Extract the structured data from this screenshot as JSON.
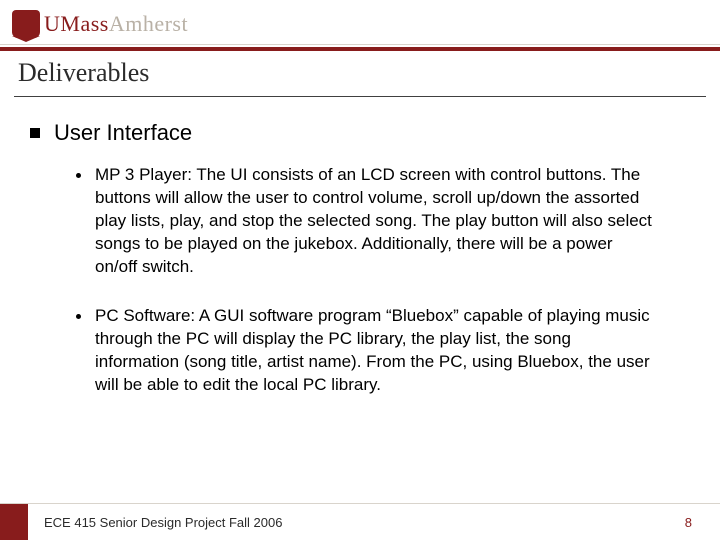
{
  "brand": {
    "u": "U",
    "mass": "Mass",
    "amherst": "Amherst"
  },
  "title": "Deliverables",
  "section": "User Interface",
  "bullets": [
    "MP 3 Player: The UI consists of an LCD screen with control buttons.  The buttons will allow the user to control volume, scroll up/down the assorted play lists, play, and stop the selected song.  The play button will also select songs to be played on the jukebox.  Additionally, there will be a power on/off switch.",
    "PC Software: A GUI software program “Bluebox” capable of playing music through the PC will display the PC library, the play list, the song information (song title, artist name).  From the PC, using Bluebox, the user will be able to edit the local PC library."
  ],
  "footer": "ECE 415 Senior Design Project Fall 2006",
  "page": "8"
}
